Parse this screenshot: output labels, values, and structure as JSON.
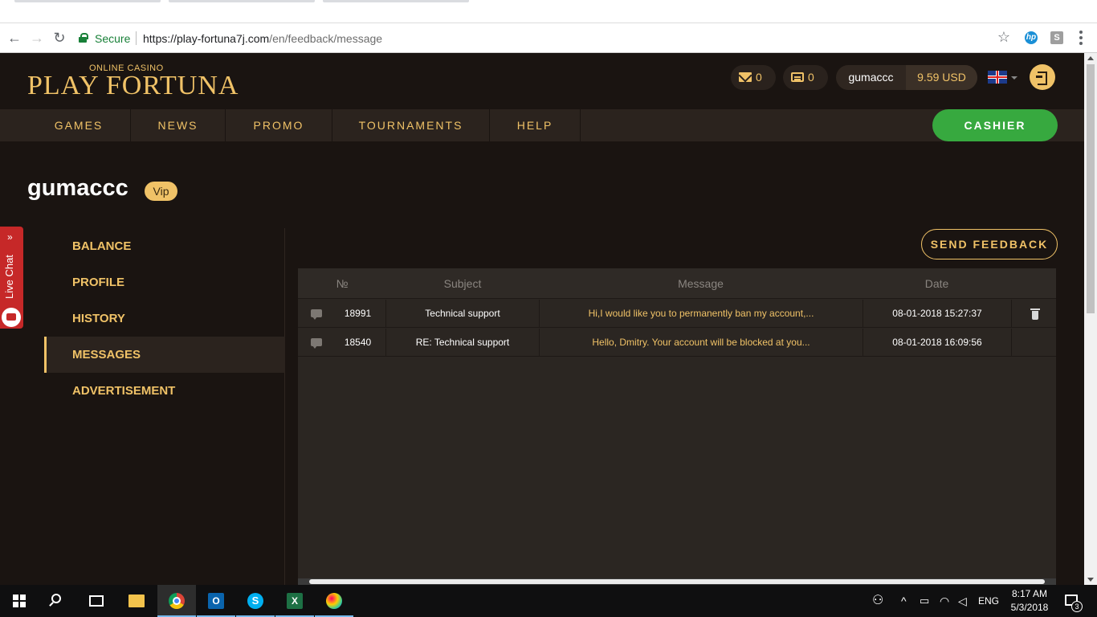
{
  "browser": {
    "secure_label": "Secure",
    "url_host": "https://play-fortuna7j.com",
    "url_path": "/en/feedback/message"
  },
  "header": {
    "logo_tagline": "ONLINE CASINO",
    "logo_name": "PLAY FORTUNA",
    "mail_count": "0",
    "chat_count": "0",
    "username": "gumaccc",
    "balance": "9.59 USD"
  },
  "nav": {
    "items": [
      {
        "label": "GAMES"
      },
      {
        "label": "NEWS"
      },
      {
        "label": "PROMO"
      },
      {
        "label": "TOURNAMENTS"
      },
      {
        "label": "HELP"
      }
    ],
    "cashier_label": "CASHIER"
  },
  "profile": {
    "username": "gumaccc",
    "badge": "Vip"
  },
  "livechat": {
    "label": "Live Chat",
    "chevron": "»"
  },
  "sidebar": {
    "items": [
      {
        "label": "BALANCE",
        "active": false
      },
      {
        "label": "PROFILE",
        "active": false
      },
      {
        "label": "HISTORY",
        "active": false
      },
      {
        "label": "MESSAGES",
        "active": true
      },
      {
        "label": "ADVERTISEMENT",
        "active": false
      }
    ]
  },
  "feedback": {
    "send_label": "SEND FEEDBACK",
    "columns": {
      "number": "№",
      "subject": "Subject",
      "message": "Message",
      "date": "Date"
    },
    "rows": [
      {
        "id": "18991",
        "subject": "Technical support",
        "message": "Hi,I would like you to permanently ban my account,...",
        "date": "08-01-2018 15:27:37",
        "deletable": true
      },
      {
        "id": "18540",
        "subject": "RE: Technical support",
        "message": "Hello, Dmitry. Your account will be blocked at you...",
        "date": "08-01-2018 16:09:56",
        "deletable": false
      }
    ]
  },
  "taskbar": {
    "language": "ENG",
    "time": "8:17 AM",
    "date": "5/3/2018",
    "notifications": "3",
    "outlook_letter": "O",
    "skype_letter": "S",
    "excel_letter": "X"
  },
  "colors": {
    "accent_gold": "#f0c267",
    "cashier_green": "#37a93f",
    "background": "#1a1411",
    "livechat_red": "#c62828"
  }
}
